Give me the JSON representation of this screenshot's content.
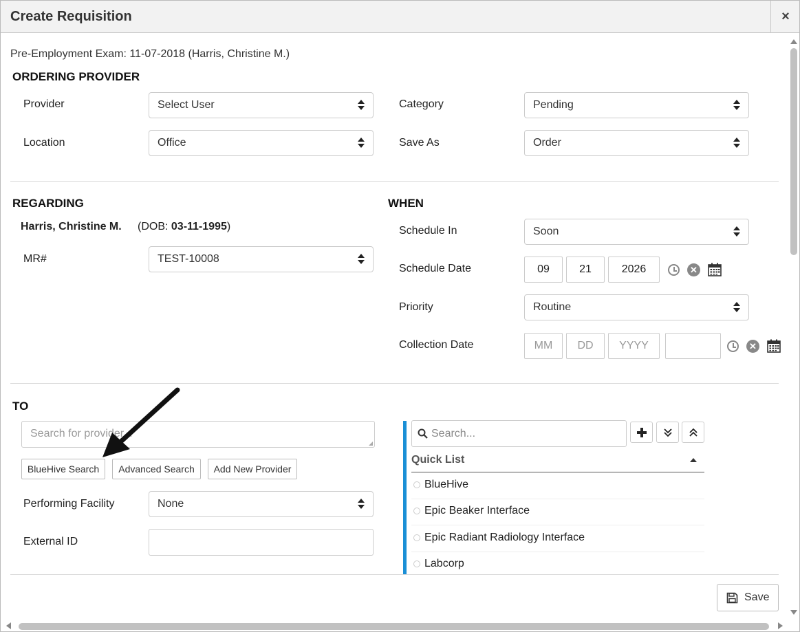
{
  "dialog": {
    "title": "Create Requisition",
    "close_label": "×",
    "subtitle": "Pre-Employment Exam: 11-07-2018 (Harris, Christine M.)"
  },
  "ordering_provider": {
    "heading": "ORDERING PROVIDER",
    "provider_label": "Provider",
    "provider_value": "Select User",
    "location_label": "Location",
    "location_value": "Office",
    "category_label": "Category",
    "category_value": "Pending",
    "save_as_label": "Save As",
    "save_as_value": "Order"
  },
  "regarding": {
    "heading": "REGARDING",
    "patient_name": "Harris, Christine M.",
    "dob_prefix": "(DOB: ",
    "dob_value": "03-11-1995",
    "dob_suffix": ")",
    "mr_label": "MR#",
    "mr_value": "TEST-10008"
  },
  "when": {
    "heading": "WHEN",
    "schedule_in_label": "Schedule In",
    "schedule_in_value": "Soon",
    "schedule_date_label": "Schedule Date",
    "schedule_month": "09",
    "schedule_day": "21",
    "schedule_year": "2026",
    "priority_label": "Priority",
    "priority_value": "Routine",
    "collection_date_label": "Collection Date",
    "collection_month_placeholder": "MM",
    "collection_day_placeholder": "DD",
    "collection_year_placeholder": "YYYY"
  },
  "to": {
    "heading": "TO",
    "search_placeholder": "Search for provider...",
    "bluehive_search": "BlueHive Search",
    "advanced_search": "Advanced Search",
    "add_new_provider": "Add New Provider",
    "performing_facility_label": "Performing Facility",
    "performing_facility_value": "None",
    "external_id_label": "External ID"
  },
  "quick_list": {
    "search_placeholder": "Search...",
    "heading": "Quick List",
    "items": [
      "BlueHive",
      "Epic Beaker Interface",
      "Epic Radiant Radiology Interface",
      "Labcorp"
    ]
  },
  "footer": {
    "save_label": "Save"
  },
  "colors": {
    "accent_bar": "#1a8fd6"
  }
}
